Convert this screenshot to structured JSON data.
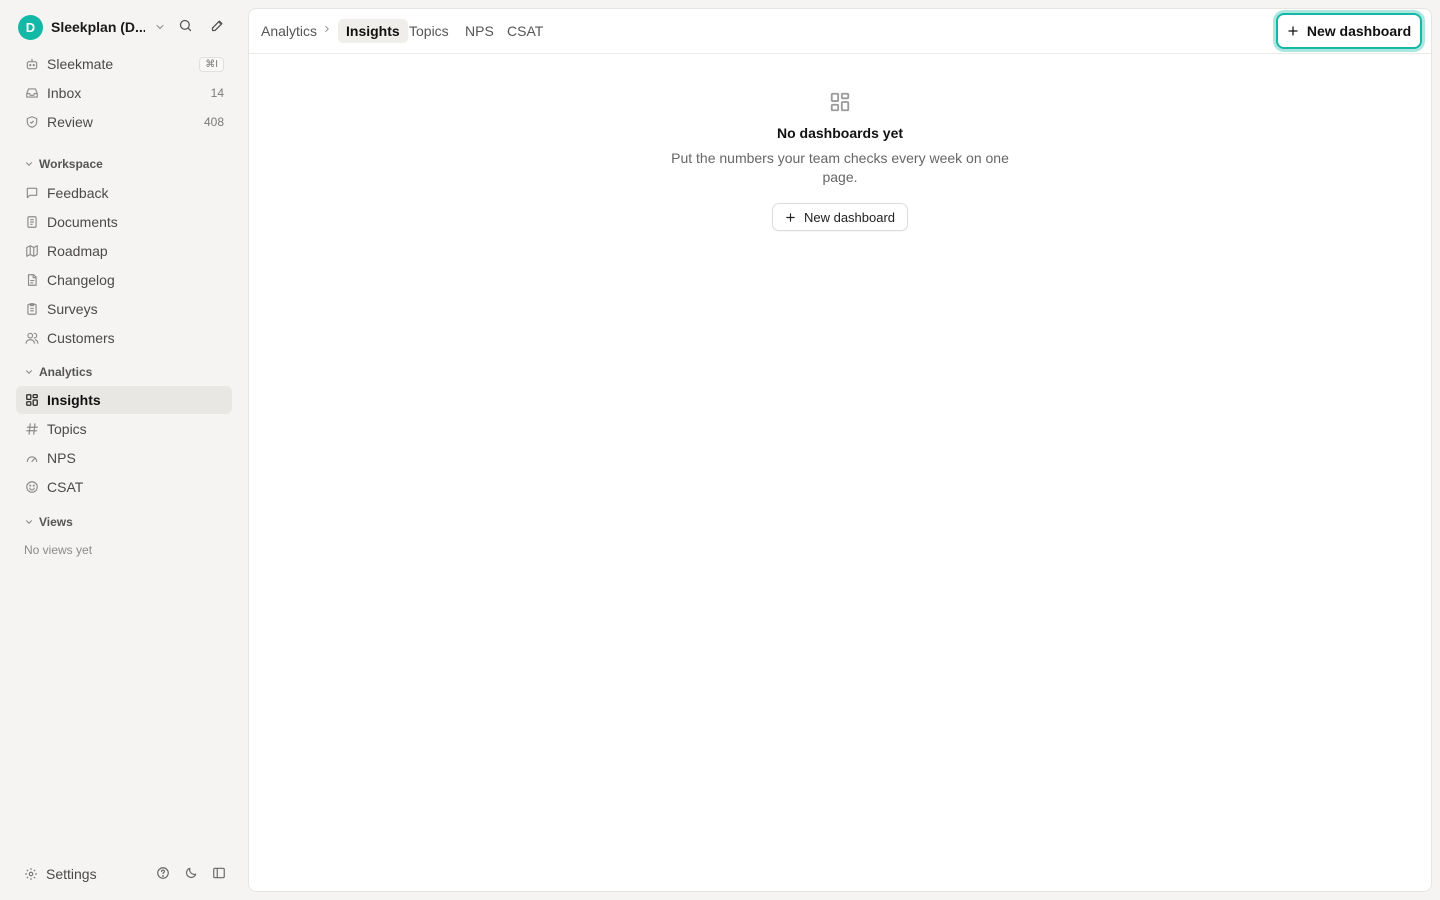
{
  "workspace": {
    "avatar_letter": "D",
    "name": "Sleekplan (D..."
  },
  "sidebar": {
    "top_items": [
      {
        "label": "Sleekmate",
        "badge": "⌘I",
        "icon": "robot-icon"
      },
      {
        "label": "Inbox",
        "badge": "14",
        "icon": "inbox-icon"
      },
      {
        "label": "Review",
        "badge": "408",
        "icon": "shield-check-icon"
      }
    ],
    "workspace_section": {
      "title": "Workspace",
      "items": [
        {
          "label": "Feedback",
          "icon": "message-icon"
        },
        {
          "label": "Documents",
          "icon": "documents-icon"
        },
        {
          "label": "Roadmap",
          "icon": "map-icon"
        },
        {
          "label": "Changelog",
          "icon": "file-icon"
        },
        {
          "label": "Surveys",
          "icon": "clipboard-icon"
        },
        {
          "label": "Customers",
          "icon": "users-icon"
        }
      ]
    },
    "analytics_section": {
      "title": "Analytics",
      "items": [
        {
          "label": "Insights",
          "icon": "grid-icon",
          "active": true
        },
        {
          "label": "Topics",
          "icon": "hash-icon"
        },
        {
          "label": "NPS",
          "icon": "gauge-icon"
        },
        {
          "label": "CSAT",
          "icon": "smile-icon"
        }
      ]
    },
    "views_section": {
      "title": "Views",
      "empty_text": "No views yet"
    },
    "footer": {
      "settings_label": "Settings"
    }
  },
  "header": {
    "breadcrumb_root": "Analytics",
    "tabs": [
      {
        "label": "Insights",
        "active": true
      },
      {
        "label": "Topics"
      },
      {
        "label": "NPS"
      },
      {
        "label": "CSAT"
      }
    ],
    "primary_button_label": "New dashboard"
  },
  "empty_state": {
    "title": "No dashboards yet",
    "subtitle": "Put the numbers your team checks every week on one page.",
    "button_label": "New dashboard"
  },
  "colors": {
    "accent": "#14b8a6",
    "sidebar_bg": "#f5f4f2",
    "main_bg": "#ffffff"
  }
}
